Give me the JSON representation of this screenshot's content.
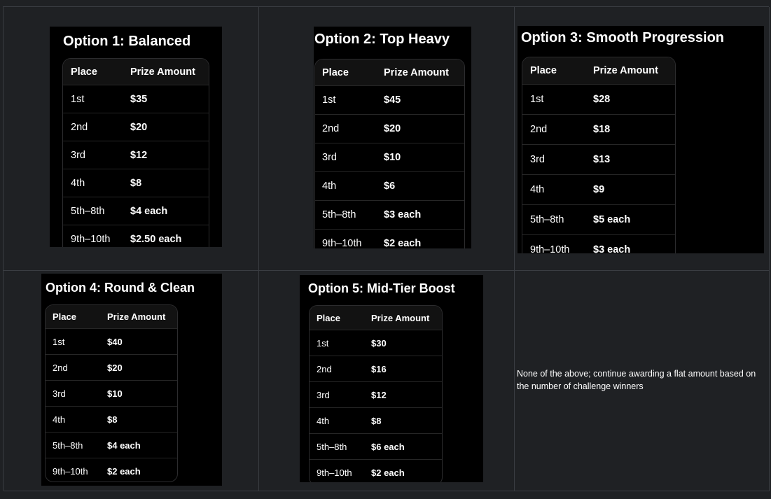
{
  "columns": {
    "place": "Place",
    "prize": "Prize Amount"
  },
  "options": [
    {
      "title": "Option 1: Balanced",
      "rows": [
        {
          "place": "1st",
          "prize": "$35"
        },
        {
          "place": "2nd",
          "prize": "$20"
        },
        {
          "place": "3rd",
          "prize": "$12"
        },
        {
          "place": "4th",
          "prize": "$8"
        },
        {
          "place": "5th–8th",
          "prize": "$4 each"
        },
        {
          "place": "9th–10th",
          "prize": "$2.50 each"
        }
      ]
    },
    {
      "title": "Option 2: Top Heavy",
      "rows": [
        {
          "place": "1st",
          "prize": "$45"
        },
        {
          "place": "2nd",
          "prize": "$20"
        },
        {
          "place": "3rd",
          "prize": "$10"
        },
        {
          "place": "4th",
          "prize": "$6"
        },
        {
          "place": "5th–8th",
          "prize": "$3 each"
        },
        {
          "place": "9th–10th",
          "prize": "$2 each"
        }
      ]
    },
    {
      "title": "Option 3: Smooth Progression",
      "rows": [
        {
          "place": "1st",
          "prize": "$28"
        },
        {
          "place": "2nd",
          "prize": "$18"
        },
        {
          "place": "3rd",
          "prize": "$13"
        },
        {
          "place": "4th",
          "prize": "$9"
        },
        {
          "place": "5th–8th",
          "prize": "$5 each"
        },
        {
          "place": "9th–10th",
          "prize": "$3 each"
        }
      ]
    },
    {
      "title": "Option 4: Round & Clean",
      "rows": [
        {
          "place": "1st",
          "prize": "$40"
        },
        {
          "place": "2nd",
          "prize": "$20"
        },
        {
          "place": "3rd",
          "prize": "$10"
        },
        {
          "place": "4th",
          "prize": "$8"
        },
        {
          "place": "5th–8th",
          "prize": "$4 each"
        },
        {
          "place": "9th–10th",
          "prize": "$2 each"
        }
      ]
    },
    {
      "title": "Option 5: Mid-Tier Boost",
      "rows": [
        {
          "place": "1st",
          "prize": "$30"
        },
        {
          "place": "2nd",
          "prize": "$16"
        },
        {
          "place": "3rd",
          "prize": "$12"
        },
        {
          "place": "4th",
          "prize": "$8"
        },
        {
          "place": "5th–8th",
          "prize": "$6 each"
        },
        {
          "place": "9th–10th",
          "prize": "$2 each"
        }
      ]
    }
  ],
  "none_option": "None of the above; continue awarding a flat amount based on the number of challenge winners"
}
